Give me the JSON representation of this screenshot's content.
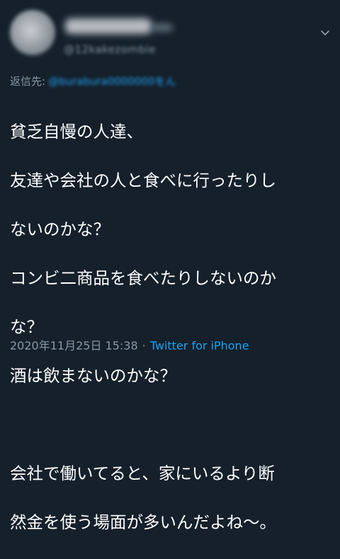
{
  "tweet": {
    "handle": "@12kakezombie",
    "reply_prefix": "返信先:",
    "reply_to": "@burabura0000000をん",
    "lines": [
      "貧乏自慢の人達、",
      "友達や会社の人と食べに行ったりし",
      "ないのかな？",
      "コンビ二商品を食べたりしないのか",
      "な？",
      "酒は飲まないのかな？",
      "",
      "会社で働いてると、家にいるより断",
      "然金を使う場面が多いんだよね〜。"
    ],
    "timestamp": "2020年11月25日 15:38",
    "separator": "·",
    "source": "Twitter for iPhone"
  },
  "icons": {
    "menu": "chevron-down-icon",
    "avatar": "avatar"
  },
  "colors": {
    "background": "#15202b",
    "text": "#ffffff",
    "secondary": "#8899a6",
    "link": "#1da1f2"
  }
}
